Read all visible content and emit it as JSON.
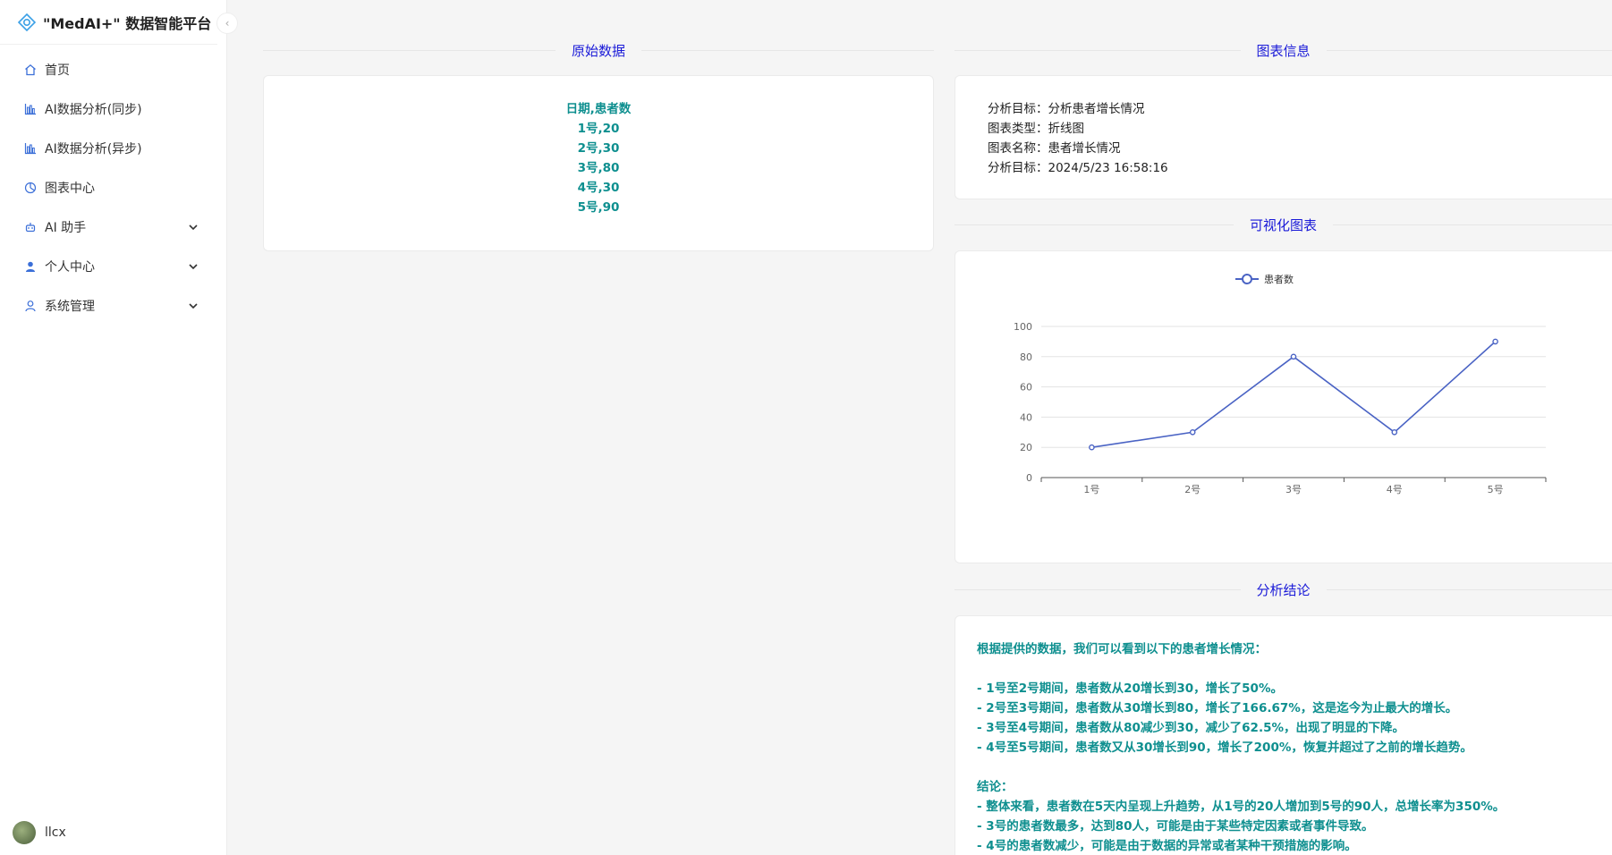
{
  "app": {
    "title": "\"MedAI+\" 数据智能平台"
  },
  "sidebar": {
    "items": [
      {
        "label": "首页",
        "icon": "home-icon",
        "has_children": false
      },
      {
        "label": "AI数据分析(同步)",
        "icon": "bar-chart-icon",
        "has_children": false
      },
      {
        "label": "AI数据分析(异步)",
        "icon": "bar-chart-icon",
        "has_children": false
      },
      {
        "label": "图表中心",
        "icon": "pie-chart-icon",
        "has_children": false
      },
      {
        "label": "AI 助手",
        "icon": "robot-icon",
        "has_children": true
      },
      {
        "label": "个人中心",
        "icon": "user-icon",
        "has_children": true
      },
      {
        "label": "系统管理",
        "icon": "user-admin-icon",
        "has_children": true
      }
    ],
    "username": "llcx"
  },
  "raw": {
    "title": "原始数据",
    "lines": [
      "日期,患者数",
      "1号,20",
      "2号,30",
      "3号,80",
      "4号,30",
      "5号,90"
    ]
  },
  "info": {
    "title": "图表信息",
    "lines": [
      "分析目标：分析患者增长情况",
      "图表类型：折线图",
      "图表名称：患者增长情况",
      "分析目标：2024/5/23 16:58:16"
    ]
  },
  "visual": {
    "title": "可视化图表"
  },
  "chart_data": {
    "type": "line",
    "categories": [
      "1号",
      "2号",
      "3号",
      "4号",
      "5号"
    ],
    "series": [
      {
        "name": "患者数",
        "values": [
          20,
          30,
          80,
          30,
          90
        ],
        "color": "#4a63c4"
      }
    ],
    "ylim": [
      0,
      100
    ],
    "yticks": [
      0,
      20,
      40,
      60,
      80,
      100
    ],
    "legend": "top-center",
    "grid": true
  },
  "conclusion": {
    "title": "分析结论",
    "lines": [
      "根据提供的数据，我们可以看到以下的患者增长情况：",
      "",
      "- 1号至2号期间，患者数从20增长到30，增长了50%。",
      "- 2号至3号期间，患者数从30增长到80，增长了166.67%，这是迄今为止最大的增长。",
      "- 3号至4号期间，患者数从80减少到30，减少了62.5%，出现了明显的下降。",
      "- 4号至5号期间，患者数又从30增长到90，增长了200%，恢复并超过了之前的增长趋势。",
      "",
      "结论：",
      "- 整体来看，患者数在5天内呈现上升趋势，从1号的20人增加到5号的90人，总增长率为350%。",
      "- 3号的患者数最多，达到80人，可能是由于某些特定因素或者事件导致。",
      "- 4号的患者数减少，可能是由于数据的异常或者某种干预措施的影响。"
    ]
  }
}
